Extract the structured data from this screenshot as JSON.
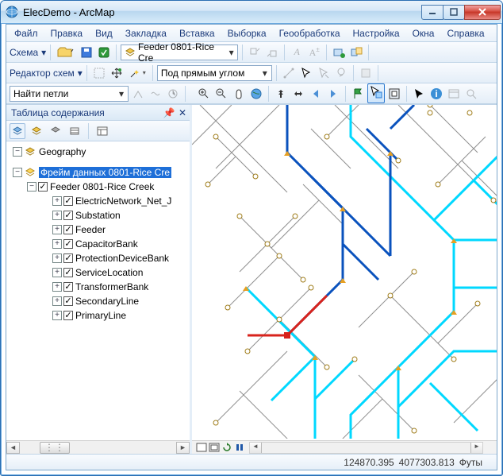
{
  "title": "ElecDemo - ArcMap",
  "menus": [
    "Файл",
    "Правка",
    "Вид",
    "Закладка",
    "Вставка",
    "Выборка",
    "Геообработка",
    "Настройка",
    "Окна",
    "Справка"
  ],
  "toolbar1": {
    "label": "Схема",
    "feeder_option": "Feeder 0801-Rice Cre"
  },
  "toolbar2": {
    "label": "Редактор схем",
    "combo": "Под прямым углом"
  },
  "toolbar3": {
    "combo": "Найти петли"
  },
  "toc": {
    "title": "Таблица содержания",
    "root": "Geography",
    "frame": "Фрейм данных 0801-Rice Cre",
    "layer_group": "Feeder 0801-Rice Creek",
    "layers": [
      "ElectricNetwork_Net_J",
      "Substation",
      "Feeder",
      "CapacitorBank",
      "ProtectionDeviceBank",
      "ServiceLocation",
      "TransformerBank",
      "SecondaryLine",
      "PrimaryLine"
    ]
  },
  "status": {
    "x": "124870.395",
    "y": "4077303.813",
    "units": "Футы"
  },
  "colors": {
    "accent_blue": "#1e6fd8",
    "line_primary": "#0a52bd",
    "line_secondary": "#00d8ff",
    "line_red": "#d8231c",
    "line_gray": "#8f8f8f"
  }
}
